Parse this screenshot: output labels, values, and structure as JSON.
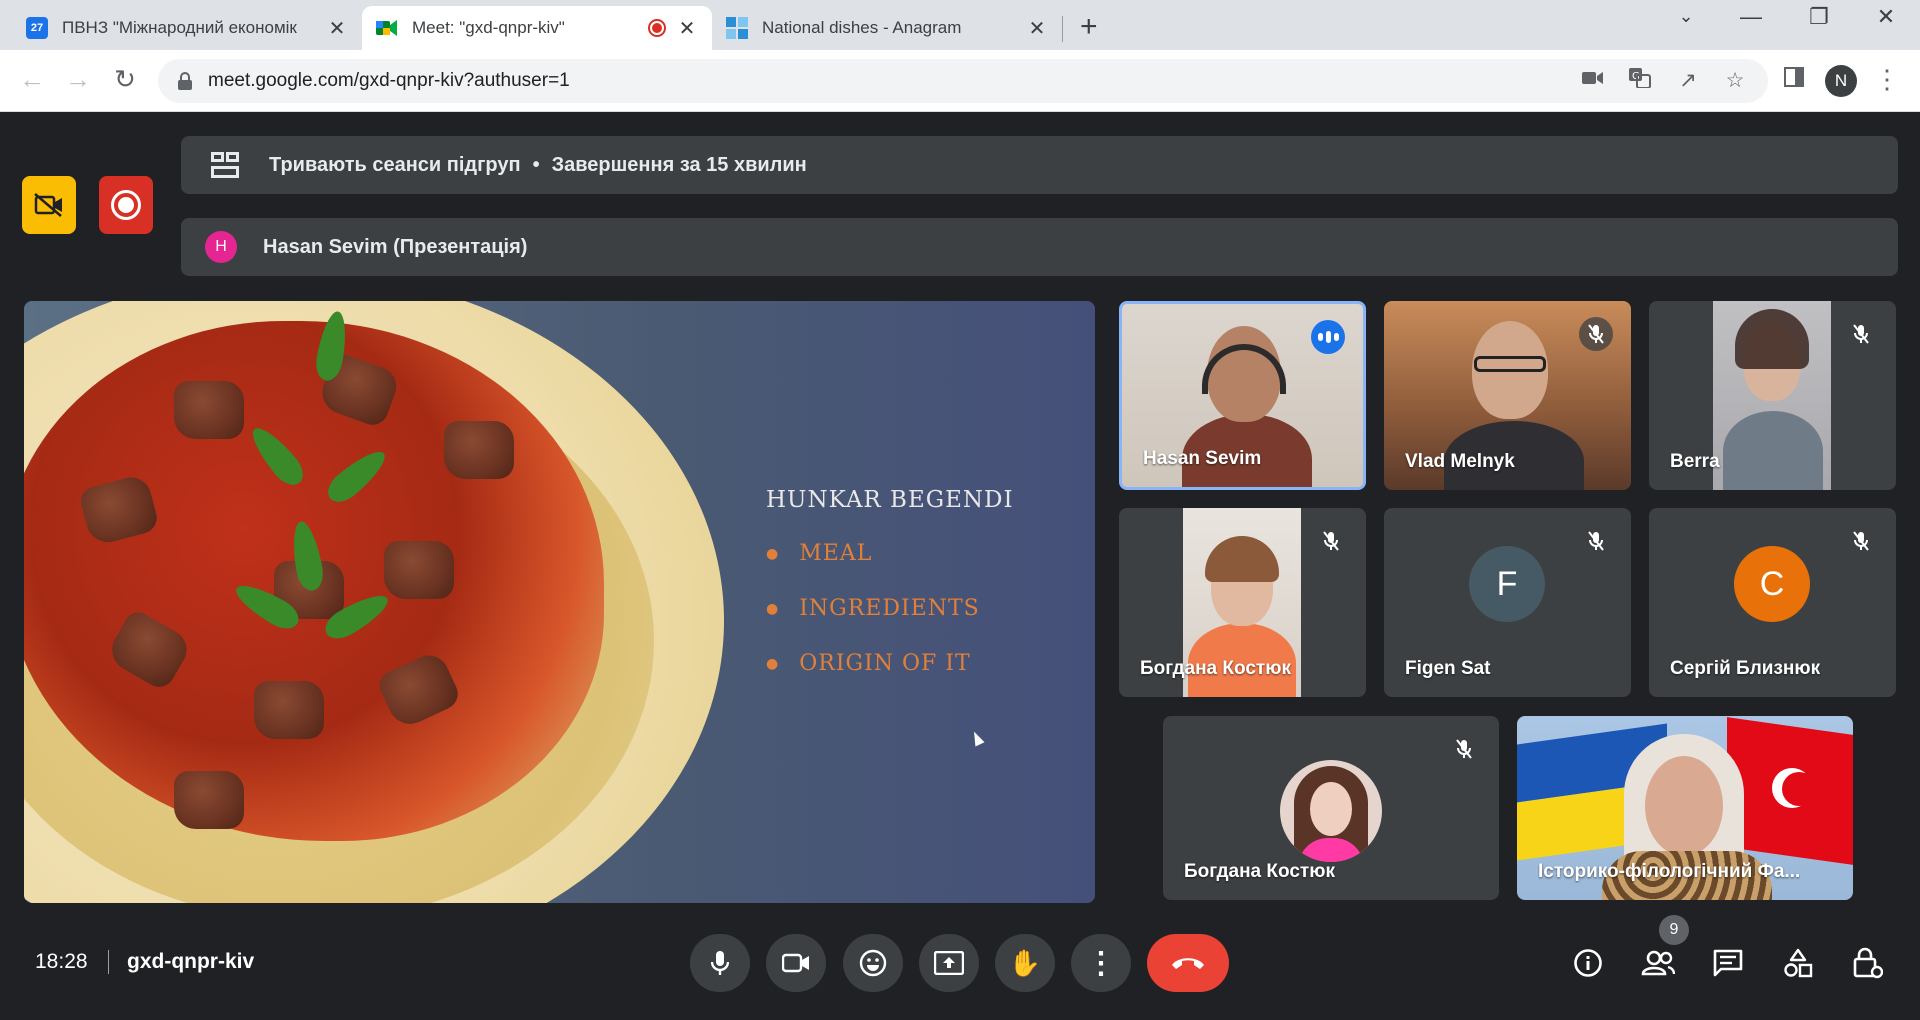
{
  "browser": {
    "tabs": [
      {
        "title": "ПВНЗ \"Міжнародний економік",
        "favicon": "calendar-icon",
        "favicon_text": "27",
        "favicon_color": "#1a73e8"
      },
      {
        "title": "Meet: \"gxd-qnpr-kiv\"",
        "favicon": "google-meet-icon",
        "favicon_color": "#00832d",
        "recording": true
      },
      {
        "title": "National dishes - Anagram",
        "favicon": "wordwall-icon",
        "favicon_color": "#2a8fd6"
      }
    ],
    "url": "meet.google.com/gxd-qnpr-kiv?authuser=1",
    "profile_initial": "N"
  },
  "meet": {
    "breakout_banner": {
      "text": "Тривають сеанси підгруп",
      "separator": "•",
      "time_text": "Завершення за 15 хвилин"
    },
    "presenter_banner": {
      "initial": "H",
      "text": "Hasan Sevim (Презентація)"
    },
    "slide": {
      "title": "HUNKAR BEGENDI",
      "bullets": [
        "MEAL",
        "INGREDIENTS",
        "ORIGIN OF IT"
      ]
    },
    "participants": [
      {
        "name": "Hasan Sevim",
        "status": "speaking"
      },
      {
        "name": "Vlad Melnyk",
        "status": "muted"
      },
      {
        "name": "Berra",
        "status": "muted"
      },
      {
        "name": "Богдана Костюк",
        "status": "muted"
      },
      {
        "name": "Figen Sat",
        "status": "muted",
        "initial": "F",
        "avatar_color": "#455a64"
      },
      {
        "name": "Сергій Близнюк",
        "status": "muted",
        "initial": "C",
        "avatar_color": "#e8710a"
      },
      {
        "name": "Богдана Костюк",
        "status": "muted"
      },
      {
        "name": "Історико-філологічний Фа...",
        "status": "none"
      }
    ],
    "bottom_bar": {
      "time": "18:28",
      "meeting_code": "gxd-qnpr-kiv",
      "participants_count": "9"
    }
  }
}
